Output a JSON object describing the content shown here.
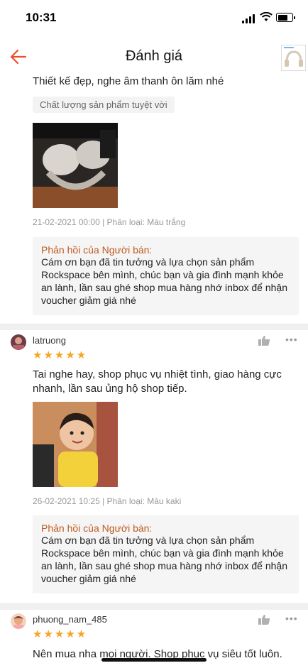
{
  "status": {
    "time": "10:31"
  },
  "nav": {
    "title": "Đánh giá"
  },
  "review_top": {
    "text": "Thiết kế đẹp, nghe âm thanh ôn lăm nhé",
    "tag": "Chất lượng sản phẩm tuyệt vời",
    "meta": "21-02-2021 00:00 | Phân loại: Màu trắng",
    "reply_title": "Phản hồi của Người bán:",
    "reply_body": "Cám ơn bạn đã tin tưởng và lựa chọn sản phẩm Rockspace bên mình, chúc bạn và gia đình mạnh khỏe an lành, lần sau ghé shop mua hàng nhớ inbox để nhận voucher giảm giá nhé"
  },
  "review_2": {
    "username": "latruong",
    "rating": 5,
    "stars": "★★★★★",
    "text": "Tai nghe hay, shop phục vụ nhiệt tình, giao hàng cực nhanh, lần sau ủng hộ shop tiếp.",
    "meta": "26-02-2021 10:25 | Phân loại: Màu kaki",
    "reply_title": "Phản hồi của Người bán:",
    "reply_body": "Cám ơn bạn đã tin tưởng và lựa chọn sản phẩm Rockspace bên mình, chúc bạn và gia đình mạnh khỏe an lành, lần sau ghé shop mua hàng nhớ inbox để nhận voucher giảm giá nhé"
  },
  "review_3": {
    "username": "phuong_nam_485",
    "rating": 5,
    "stars": "★★★★★",
    "text": "Nên mua nha mọi người. Shop phục vụ siêu tốt luôn."
  },
  "colors": {
    "accent": "#ee4d2d",
    "star": "#f5a623",
    "reply_title": "#c05a1f"
  },
  "icons": [
    "back-arrow-icon",
    "thumbs-up-icon",
    "more-dots-icon",
    "signal-icon",
    "wifi-icon",
    "battery-icon"
  ]
}
